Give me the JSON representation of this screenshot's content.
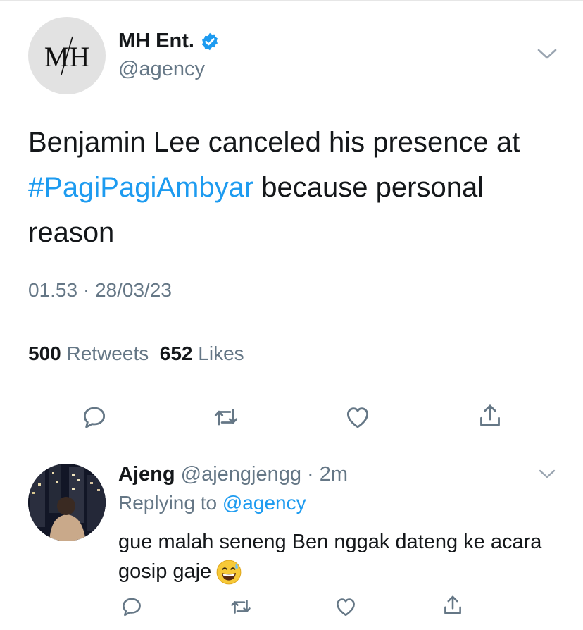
{
  "tweet": {
    "author_name": "MH Ent.",
    "author_handle": "@agency",
    "avatar_initials": "MH",
    "text_before": "Benjamin Lee canceled his presence at ",
    "hashtag": "#PagiPagiAmbyar",
    "text_after": " because personal reason",
    "timestamp": "01.53 · 28/03/23",
    "retweet_count": "500",
    "retweet_label": "Retweets",
    "like_count": "652",
    "like_label": "Likes"
  },
  "reply": {
    "author_name": "Ajeng",
    "author_handle": "@ajengjengg",
    "time": "· 2m",
    "replying_label": "Replying to",
    "replying_to": "@agency",
    "text": "gue malah seneng Ben nggak dateng ke acara gosip gaje",
    "emoji_icon": "grinning-face-with-sweat-icon"
  },
  "colors": {
    "link": "#1d9bf0",
    "verified": "#1d9bf0",
    "secondary_text": "#657786",
    "icon": "#657786"
  },
  "icons": [
    "reply-icon",
    "retweet-icon",
    "like-icon",
    "share-icon",
    "chevron-down-icon",
    "verified-badge-icon"
  ]
}
